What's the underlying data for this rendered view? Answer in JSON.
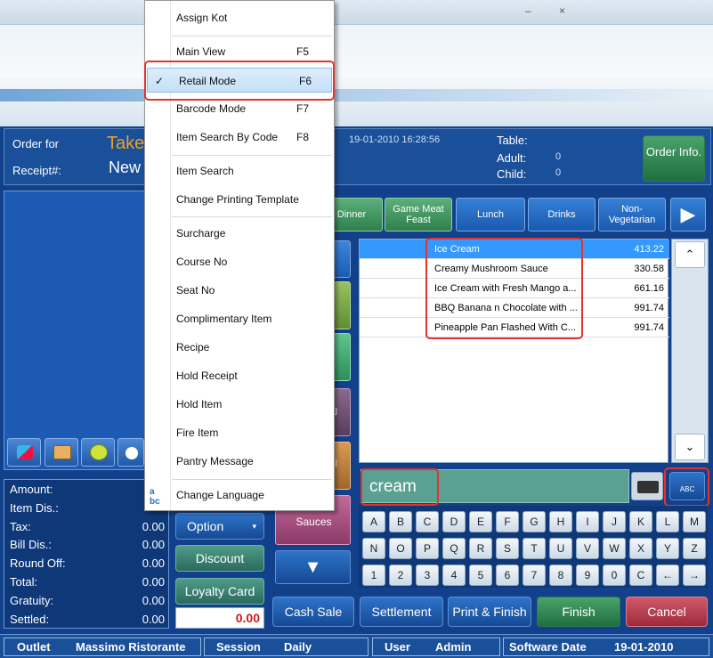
{
  "header": {
    "order_for_label": "Order for",
    "order_for_value": "Take",
    "receipt_label": "Receipt#:",
    "receipt_value": "New",
    "datetime": "19-01-2010 16:28:56",
    "table_label": "Table:",
    "adult_label": "Adult:",
    "adult_value": "0",
    "child_label": "Child:",
    "child_value": "0",
    "order_info_label": "Order Info."
  },
  "categories": [
    "Dinner",
    "Game Meat Feast",
    "Lunch",
    "Drinks",
    "Non-Vegetarian"
  ],
  "subcategory_partial": [
    "al",
    "al"
  ],
  "subcategory_sauces": "Sauces",
  "items": [
    {
      "name": "Ice Cream",
      "price": "413.22"
    },
    {
      "name": "Creamy Mushroom Sauce",
      "price": "330.58"
    },
    {
      "name": "Ice Cream with Fresh Mango a...",
      "price": "661.16"
    },
    {
      "name": "BBQ Banana n Chocolate with ...",
      "price": "991.74"
    },
    {
      "name": "Pineapple Pan Flashed With C...",
      "price": "991.74"
    }
  ],
  "search": {
    "value": "cream",
    "abc_label": "ABC"
  },
  "keyboard": {
    "row1": [
      "A",
      "B",
      "C",
      "D",
      "E",
      "F",
      "G",
      "H",
      "I",
      "J",
      "K",
      "L",
      "M"
    ],
    "row2": [
      "N",
      "O",
      "P",
      "Q",
      "R",
      "S",
      "T",
      "U",
      "V",
      "W",
      "X",
      "Y",
      "Z"
    ],
    "row3": [
      "1",
      "2",
      "3",
      "4",
      "5",
      "6",
      "7",
      "8",
      "9",
      "0",
      "C",
      "←",
      "→"
    ]
  },
  "totals": [
    {
      "label": "Amount:",
      "value": ""
    },
    {
      "label": "Item Dis.:",
      "value": ""
    },
    {
      "label": "Tax:",
      "value": "0.00"
    },
    {
      "label": "Bill Dis.:",
      "value": "0.00"
    },
    {
      "label": "Round Off:",
      "value": "0.00"
    },
    {
      "label": "Total:",
      "value": "0.00"
    },
    {
      "label": "Gratuity:",
      "value": "0.00"
    },
    {
      "label": "Settled:",
      "value": "0.00"
    }
  ],
  "actions": {
    "option": "Option",
    "discount": "Discount",
    "loyalty": "Loyalty Card",
    "amount_display": "0.00",
    "cash_sale": "Cash Sale",
    "settlement": "Settlement",
    "print_finish": "Print & Finish",
    "finish": "Finish",
    "cancel": "Cancel"
  },
  "status": {
    "outlet_label": "Outlet",
    "outlet_value": "Massimo Ristorante",
    "session_label": "Session",
    "session_value": "Daily",
    "user_label": "User",
    "user_value": "Admin",
    "date_label": "Software Date",
    "date_value": "19-01-2010"
  },
  "menu": {
    "items": [
      {
        "label": "Assign Kot",
        "key": ""
      },
      {
        "label": "Main View",
        "key": "F5"
      },
      {
        "label": "Retail Mode",
        "key": "F6",
        "checked": true
      },
      {
        "label": "Barcode Mode",
        "key": "F7"
      },
      {
        "label": "Item Search By Code",
        "key": "F8"
      },
      {
        "label": "Item Search",
        "key": ""
      },
      {
        "label": "Change Printing Template",
        "key": ""
      },
      {
        "label": "Surcharge",
        "key": ""
      },
      {
        "label": "Course No",
        "key": ""
      },
      {
        "label": "Seat No",
        "key": ""
      },
      {
        "label": "Complimentary Item",
        "key": ""
      },
      {
        "label": "Recipe",
        "key": ""
      },
      {
        "label": "Hold Receipt",
        "key": ""
      },
      {
        "label": "Hold Item",
        "key": ""
      },
      {
        "label": "Fire Item",
        "key": ""
      },
      {
        "label": "Pantry Message",
        "key": ""
      },
      {
        "label": "Change Language",
        "key": ""
      }
    ],
    "check_mark": "✓"
  },
  "colors": {
    "accent": "#12408a",
    "highlight": "#e2342e",
    "selected_row": "#3399ff"
  }
}
